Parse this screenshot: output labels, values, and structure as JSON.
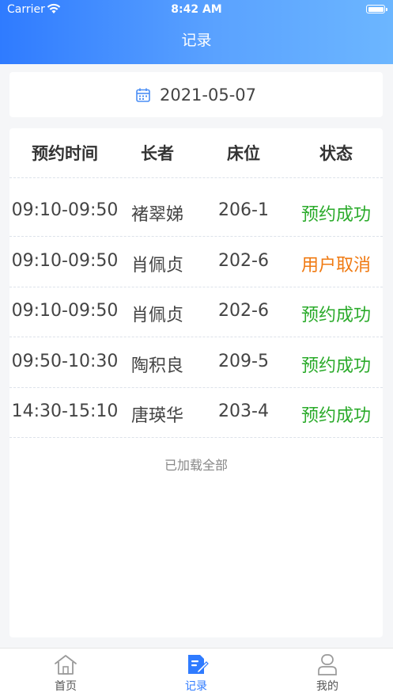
{
  "status_bar": {
    "carrier": "Carrier",
    "time": "8:42 AM"
  },
  "header": {
    "title": "记录"
  },
  "date_picker": {
    "date": "2021-05-07",
    "icon": "calendar-icon"
  },
  "table": {
    "columns": [
      "预约时间",
      "长者",
      "床位",
      "状态"
    ],
    "rows": [
      {
        "time": "09:10-09:50",
        "elder": "褚翠娣",
        "bed": "206-1",
        "status": "预约成功"
      },
      {
        "time": "09:10-09:50",
        "elder": "肖佩贞",
        "bed": "202-6",
        "status": "用户取消"
      },
      {
        "time": "09:10-09:50",
        "elder": "肖佩贞",
        "bed": "202-6",
        "status": "预约成功"
      },
      {
        "time": "09:50-10:30",
        "elder": "陶积良",
        "bed": "209-5",
        "status": "预约成功"
      },
      {
        "time": "14:30-15:10",
        "elder": "唐瑛华",
        "bed": "203-4",
        "status": "预约成功"
      }
    ],
    "footer": "已加载全部"
  },
  "status_colors": {
    "success": "#2bab2b",
    "cancelled": "#f07a12"
  },
  "tabbar": {
    "tabs": [
      {
        "label": "首页",
        "icon": "home-icon",
        "active": false
      },
      {
        "label": "记录",
        "icon": "record-edit-icon",
        "active": true
      },
      {
        "label": "我的",
        "icon": "user-icon",
        "active": false
      }
    ]
  },
  "theme": {
    "accent": "#2f7bff"
  }
}
